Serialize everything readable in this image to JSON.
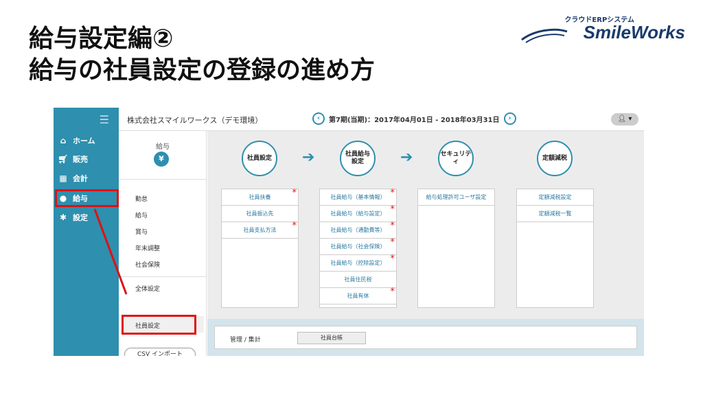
{
  "slide": {
    "title_line1": "給与設定編②",
    "title_line2": "給与の社員設定の登録の進め方"
  },
  "logo": {
    "tagline": "クラウドERPシステム",
    "name": "SmileWorks"
  },
  "sidebar": {
    "items": [
      {
        "label": "ホーム",
        "icon": "home-icon"
      },
      {
        "label": "販売",
        "icon": "cart-icon"
      },
      {
        "label": "会計",
        "icon": "calculator-icon"
      },
      {
        "label": "給与",
        "icon": "money-bag-icon"
      },
      {
        "label": "設定",
        "icon": "gear-icon"
      }
    ]
  },
  "topbar": {
    "company": "株式会社スマイルワークス（デモ環境）",
    "period": "第7期(当期)：2017年04月01日 - 2018年03月31日"
  },
  "subnav": {
    "title": "給与",
    "items": [
      "勤怠",
      "給与",
      "賞与",
      "年末調整",
      "社会保険",
      "全体設定",
      "社員設定"
    ],
    "csv_button": "CSV インポート"
  },
  "workflow": {
    "steps": [
      "社員設定",
      "社員給与\n設定",
      "セキュリティ",
      "定額減税"
    ],
    "columns": [
      {
        "items": [
          {
            "label": "社員扶養",
            "required": true
          },
          {
            "label": "社員振込先",
            "required": false
          },
          {
            "label": "社員支払方法",
            "required": true
          }
        ]
      },
      {
        "items": [
          {
            "label": "社員給与（基本情報）",
            "required": true
          },
          {
            "label": "社員給与（給与設定）",
            "required": true
          },
          {
            "label": "社員給与（通勤費等）",
            "required": true
          },
          {
            "label": "社員給与（社会保険）",
            "required": true
          },
          {
            "label": "社員給与（控除設定）",
            "required": true
          },
          {
            "label": "社員住民税",
            "required": false
          },
          {
            "label": "社員有休",
            "required": true
          }
        ]
      },
      {
        "items": [
          {
            "label": "給与処理許可ユーザ設定",
            "required": false
          }
        ]
      },
      {
        "items": [
          {
            "label": "定額減税設定",
            "required": false
          },
          {
            "label": "定額減税一覧",
            "required": false
          }
        ]
      }
    ]
  },
  "bottom": {
    "label": "管理 / 集計",
    "ledger_button": "社員台帳"
  },
  "colors": {
    "accent": "#2e8fae",
    "highlight": "#e01010"
  }
}
